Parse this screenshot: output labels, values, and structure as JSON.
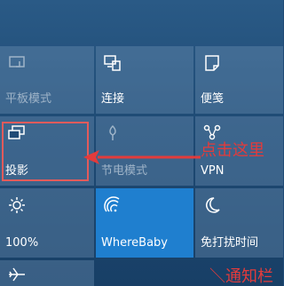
{
  "tiles": [
    {
      "label": "平板模式",
      "icon": "tablet-mode-icon",
      "state": "disabled"
    },
    {
      "label": "连接",
      "icon": "connect-icon",
      "state": "normal"
    },
    {
      "label": "便笺",
      "icon": "note-icon",
      "state": "normal"
    },
    {
      "label": "投影",
      "icon": "project-icon",
      "state": "normal"
    },
    {
      "label": "节电模式",
      "icon": "battery-saver-icon",
      "state": "disabled"
    },
    {
      "label": "VPN",
      "icon": "vpn-icon",
      "state": "normal"
    },
    {
      "label": "100%",
      "icon": "brightness-icon",
      "state": "normal"
    },
    {
      "label": "WhereBaby",
      "icon": "wifi-icon",
      "state": "active"
    },
    {
      "label": "免打扰时间",
      "icon": "quiet-hours-moon-icon",
      "state": "normal"
    },
    {
      "label": "",
      "icon": "airplane-icon",
      "state": "normal"
    }
  ],
  "annotations": {
    "click_here": "点击这里",
    "notification_bar": "＼通知栏"
  },
  "colors": {
    "tile": "#7f9fbf",
    "active_tile": "#1f7fcf",
    "annotation": "#e33b3b"
  }
}
